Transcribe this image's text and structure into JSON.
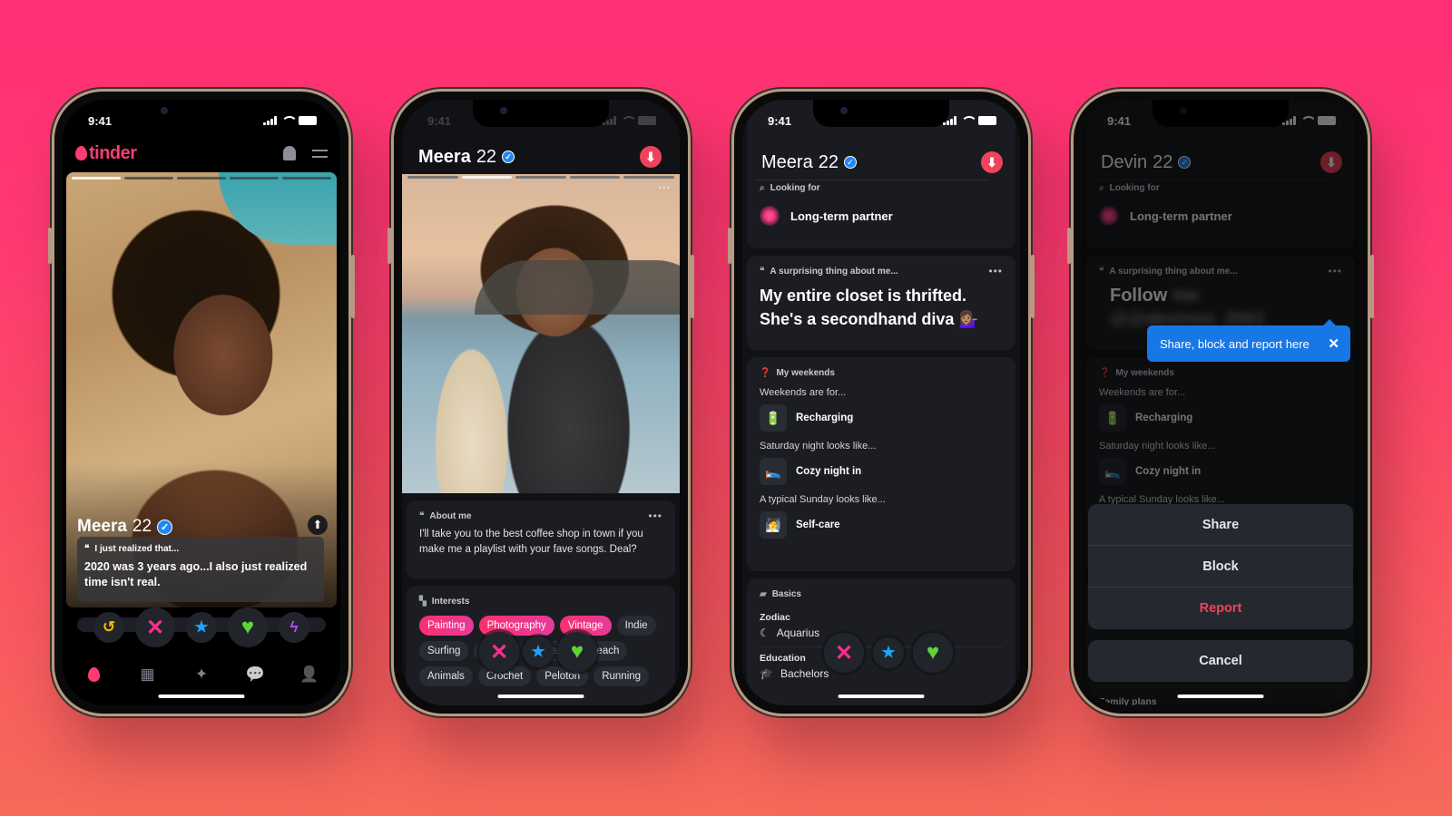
{
  "background": {
    "top_color": "#ff2f74",
    "bottom_color": "#f5695a"
  },
  "status_time": "9:41",
  "phone1": {
    "brand": "tinder",
    "brand_color": "#fe3c72",
    "icons": [
      "bell-icon",
      "sliders-icon"
    ],
    "photo_count": 5,
    "photo_active_index": 0,
    "name": "Meera",
    "age": "22",
    "prompt_question": "I just realized that...",
    "prompt_answer": "2020 was 3 years ago...I also just realized time isn't real.",
    "actions": [
      {
        "name": "rewind",
        "glyph": "↺"
      },
      {
        "name": "nope",
        "glyph": "✕"
      },
      {
        "name": "super-like",
        "glyph": "★"
      },
      {
        "name": "like",
        "glyph": "♥"
      },
      {
        "name": "boost",
        "glyph": "ϟ"
      }
    ],
    "tabs": [
      {
        "name": "home",
        "glyph": "🔥"
      },
      {
        "name": "explore",
        "glyph": "▦"
      },
      {
        "name": "gold",
        "glyph": "✦"
      },
      {
        "name": "messages",
        "glyph": "💬"
      },
      {
        "name": "profile",
        "glyph": "👤"
      }
    ]
  },
  "phone2": {
    "name": "Meera",
    "age": "22",
    "photo_count": 5,
    "photo_active_index": 1,
    "more_label": "•••",
    "about_label": "About me",
    "about_text": "I'll take you to the best coffee shop in town if you make me a playlist with your fave songs. Deal?",
    "interests_label": "Interests",
    "interests": [
      {
        "label": "Painting",
        "shared": true
      },
      {
        "label": "Photography",
        "shared": true
      },
      {
        "label": "Vintage",
        "shared": true
      },
      {
        "label": "Indie",
        "shared": false
      },
      {
        "label": "Surfing",
        "shared": false
      },
      {
        "label": "Sweets",
        "shared": false
      },
      {
        "label": "Beach",
        "shared": false
      },
      {
        "label": "Beach",
        "shared": false
      },
      {
        "label": "Animals",
        "shared": false
      },
      {
        "label": "Crochet",
        "shared": false
      },
      {
        "label": "Peloton",
        "shared": false
      },
      {
        "label": "Running",
        "shared": false
      }
    ]
  },
  "phone3": {
    "name": "Meera",
    "age": "22",
    "looking_for_label": "Looking for",
    "looking_for_value": "Long-term partner",
    "prompt_label": "A surprising thing about me...",
    "prompt_answer": "My entire closet is thrifted. She's a secondhand diva 💁🏽‍♀️",
    "weekends_label": "My weekends",
    "weekends": [
      {
        "question": "Weekends are for...",
        "answer": "Recharging",
        "emoji": "🔋"
      },
      {
        "question": "Saturday night looks like...",
        "answer": "Cozy night in",
        "emoji": "🛌"
      },
      {
        "question": "A typical Sunday looks like...",
        "answer": "Self-care",
        "emoji": "🧖"
      }
    ],
    "basics_label": "Basics",
    "basics": [
      {
        "title": "Zodiac",
        "value": "Aquarius",
        "icon": "☾"
      },
      {
        "title": "Education",
        "value": "Bachelors",
        "icon": "🎓"
      }
    ]
  },
  "phone4": {
    "name": "Devin",
    "age": "22",
    "looking_for_label": "Looking for",
    "looking_for_value": "Long-term partner",
    "prompt_label": "A surprising thing about me...",
    "prompt_answer_visible": "Follow",
    "prompt_answer_blurred": "me @@devinnn_2001",
    "tooltip_text": "Share, block and report here",
    "weekends_label": "My weekends",
    "weekends": [
      {
        "question": "Weekends are for...",
        "answer": "Recharging",
        "emoji": "🔋"
      },
      {
        "question": "Saturday night looks like...",
        "answer": "Cozy night in",
        "emoji": "🛌"
      },
      {
        "question": "A typical Sunday looks like...",
        "answer": ""
      }
    ],
    "sheet_items": [
      "Share",
      "Block",
      "Report"
    ],
    "cancel_label": "Cancel",
    "family_plans_label": "Family plans",
    "report_color": "#f0435b"
  }
}
